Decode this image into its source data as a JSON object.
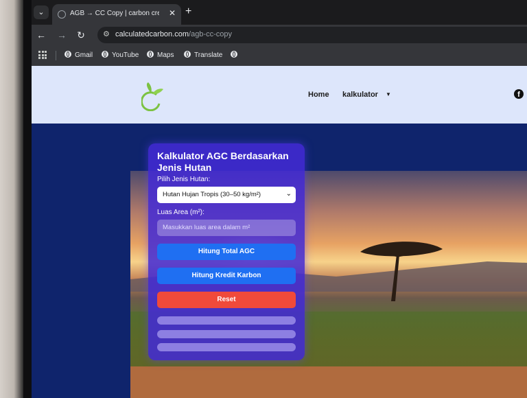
{
  "browser": {
    "tab_title": "AGB → CC Copy | carbon credit",
    "tab_close": "✕",
    "new_tab": "+",
    "url_domain": "calculatedcarbon.com",
    "url_path": "/agb-cc-copy",
    "bookmarks": [
      "Gmail",
      "YouTube",
      "Maps",
      "Translate"
    ]
  },
  "site": {
    "nav": {
      "home": "Home",
      "calculator": "kalkulator"
    }
  },
  "calculator": {
    "title": "Kalkulator AGC Berdasarkan Jenis Hutan",
    "forest_label": "Pilih Jenis Hutan:",
    "forest_selected": "Hutan Hujan Tropis (30–50 kg/m²)",
    "area_label": "Luas Area (m²):",
    "area_placeholder": "Masukkan luas area dalam m²",
    "btn_total": "Hitung Total AGC",
    "btn_credit": "Hitung Kredit Karbon",
    "btn_reset": "Reset"
  },
  "colors": {
    "header_bg": "#dde6fb",
    "page_bg": "#0f246c",
    "card_bg": "#422ad6",
    "button_blue": "#1f6ff2",
    "button_red": "#f04a3a"
  }
}
